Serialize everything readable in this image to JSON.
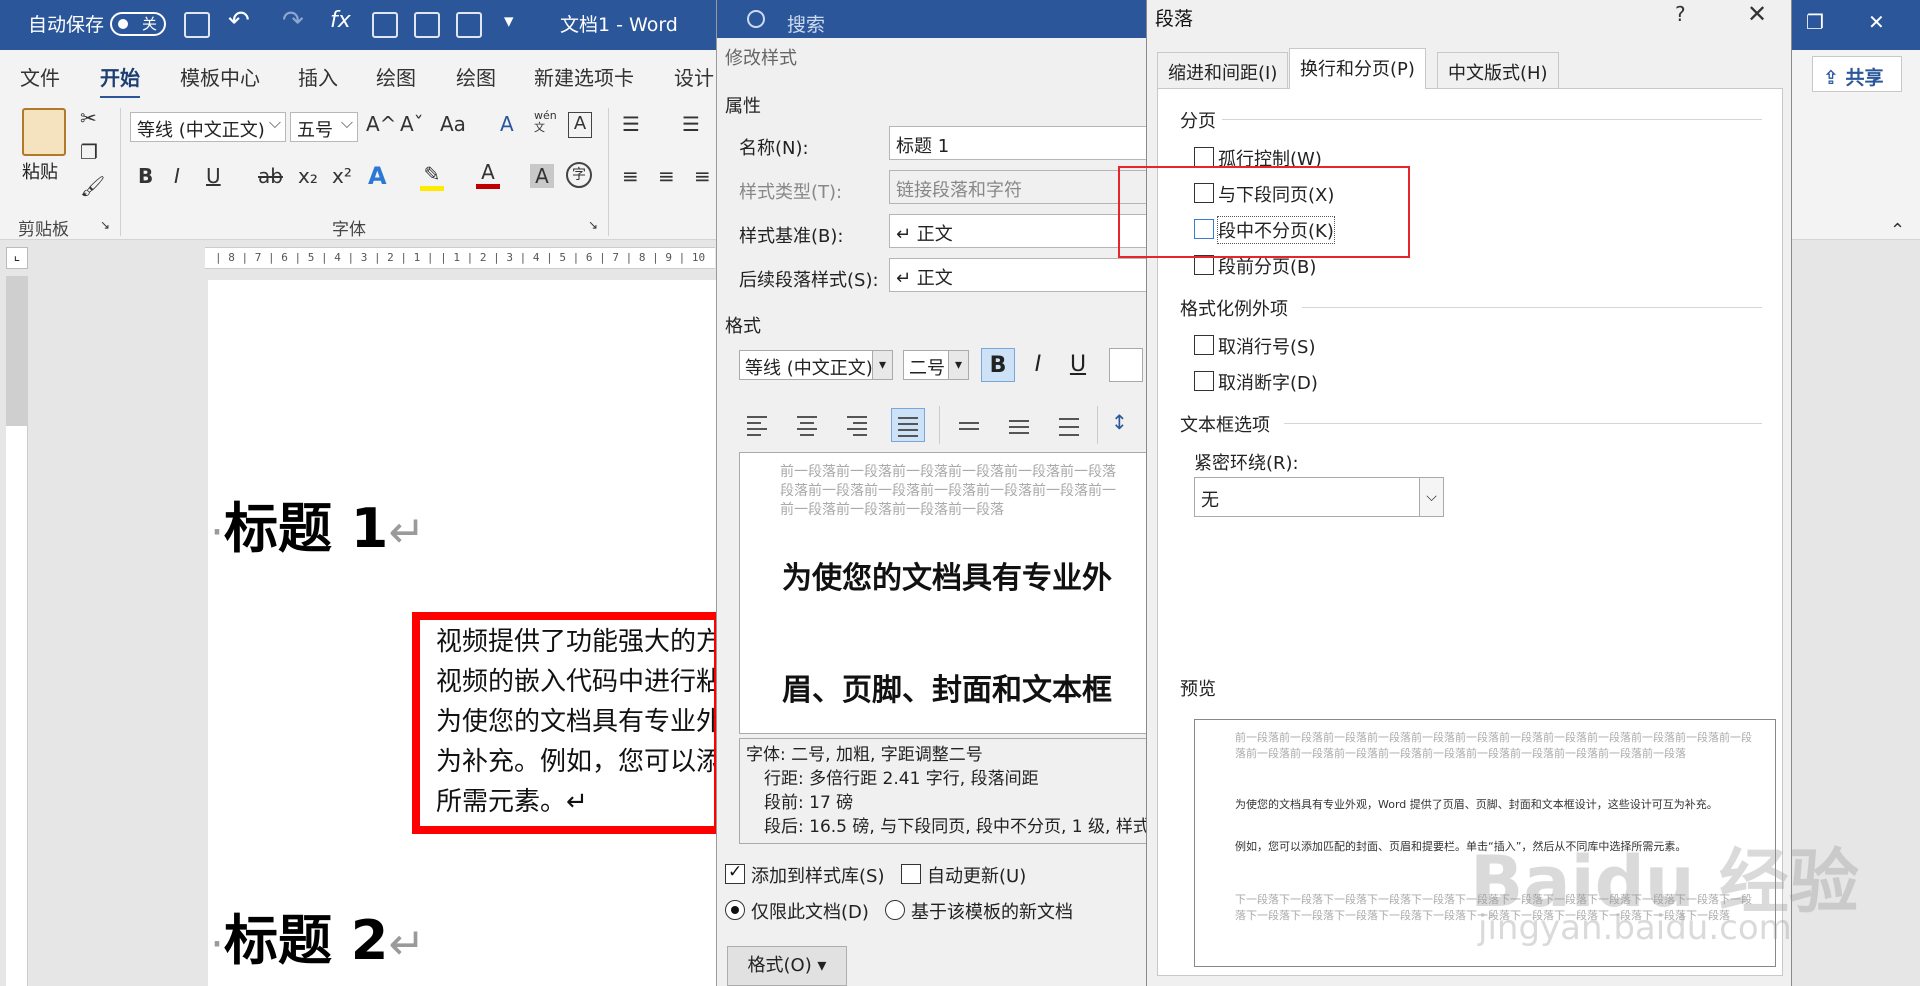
{
  "titlebar": {
    "autosave_label": "自动保存",
    "autosave_state": "关",
    "doc_title": "文档1  -  Word",
    "search_placeholder": "搜索",
    "accent_color": "#2b579a"
  },
  "tabs": [
    "文件",
    "开始",
    "模板中心",
    "插入",
    "绘图",
    "绘图",
    "新建选项卡",
    "设计"
  ],
  "active_tab": "开始",
  "share_label": "共享",
  "ribbon": {
    "paste_label": "粘贴",
    "clipboard_group": "剪贴板",
    "font_group": "字体",
    "font_name": "等线 (中文正文)",
    "font_size": "五号",
    "bold": "B",
    "italic": "I",
    "underline": "U",
    "strike": "ab",
    "subscript": "x₂",
    "superscript": "x²",
    "grow": "A^",
    "shrink": "Aˇ",
    "case": "Aa",
    "phonetic": "wén 文",
    "border_char": "A",
    "font_color_a": "A",
    "text_effect_a": "A",
    "shade_a": "A",
    "enclose": "字"
  },
  "ruler_h_text": "| 8 | 7 | 6 | 5 | 4 | 3 | 2 | 1 |   | 1 | 2 | 3 | 4 | 5 | 6 | 7 | 8 | 9 | 10",
  "document": {
    "heading1": "标题 1",
    "heading2": "标题 2",
    "para_mark": "↵",
    "body_lines": [
      "视频提供了功能强大的方",
      "视频的嵌入代码中进行粘",
      "为使您的文档具有专业外",
      "为补充。例如，您可以添",
      "所需元素。↵"
    ]
  },
  "modify_style": {
    "title": "修改样式",
    "props_section": "属性",
    "name_label": "名称(N):",
    "name_value": "标题 1",
    "type_label": "样式类型(T):",
    "type_value": "链接段落和字符",
    "base_label": "样式基准(B):",
    "base_value": "↵ 正文",
    "next_label": "后续段落样式(S):",
    "next_value": "↵ 正文",
    "format_section": "格式",
    "font_name": "等线 (中文正文)",
    "font_size": "二号",
    "bold": "B",
    "italic": "I",
    "underline": "U",
    "preview_gray_before": [
      "前一段落前一段落前一段落前一段落前一段落前一段落",
      "段落前一段落前一段落前一段落前一段落前一段落前一",
      "前一段落前一段落前一段落前一段落"
    ],
    "preview_line1": "为使您的文档具有专业外",
    "preview_line2": "眉、页脚、封面和文本框",
    "desc_lines": [
      "字体: 二号, 加粗, 字距调整二号",
      "行距: 多倍行距 2.41 字行, 段落间距",
      "段前: 17 磅",
      "段后: 16.5 磅, 与下段同页, 段中不分页, 1 级, 样式"
    ],
    "add_to_gallery": "添加到样式库(S)",
    "auto_update": "自动更新(U)",
    "only_this_doc": "仅限此文档(D)",
    "new_docs_template": "基于该模板的新文档",
    "format_button": "格式(O) ▾"
  },
  "paragraph": {
    "title": "段落",
    "help": "?",
    "close": "✕",
    "tabs": [
      "缩进和间距(I)",
      "换行和分页(P)",
      "中文版式(H)"
    ],
    "active_tab": "换行和分页(P)",
    "pagination_section": "分页",
    "widow_control": "孤行控制(W)",
    "keep_with_next": "与下段同页(X)",
    "keep_lines_together": "段中不分页(K)",
    "page_break_before": "段前分页(B)",
    "exceptions_section": "格式化例外项",
    "suppress_line_numbers": "取消行号(S)",
    "no_hyphenate": "取消断字(D)",
    "textbox_section": "文本框选项",
    "tight_wrap_label": "紧密环绕(R):",
    "tight_wrap_value": "无",
    "preview_section": "预览",
    "preview_gray_before": [
      "前一段落前一段落前一段落前一段落前一段落前一段落前一段落前一段落前一段落前一段落前一段落前一段落前一段落前一段落前一段落前一段落前一段落前一段落前一段落前一段落前一段落前一段落"
    ],
    "preview_text1": "为使您的文档具有专业外观，Word 提供了页眉、页脚、封面和文本框设计，这些设计可互为补充。",
    "preview_text2": "例如，您可以添加匹配的封面、页眉和提要栏。单击“插入”，然后从不同库中选择所需元素。",
    "preview_gray_after": [
      "下一段落下一段落下一段落下一段落下一段落下一段落下一段落下一段落下一段落下一段落下一段落下一段落下一段落下一段落下一段落下一段落下一段落下一段落下一段落下一段落下一段落下一段落下一段落"
    ],
    "highlight_color": "#e8262a"
  },
  "watermark": {
    "main": "Baidu 经验",
    "sub": "jingyan.baidu.com"
  }
}
